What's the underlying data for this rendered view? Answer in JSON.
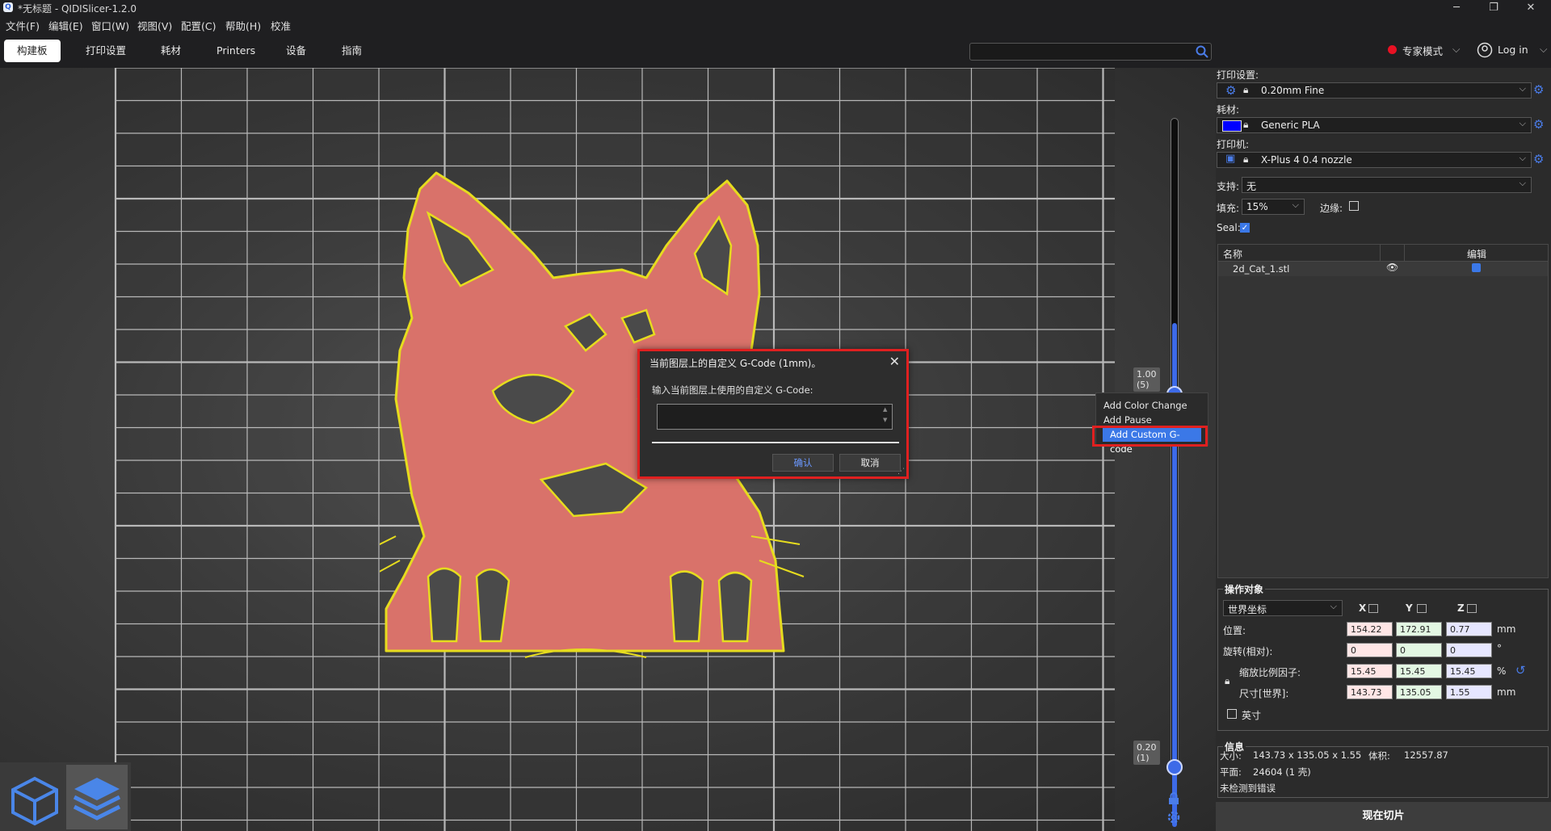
{
  "window": {
    "title": "*无标题 - QIDISlicer-1.2.0"
  },
  "menu": [
    "文件(F)",
    "编辑(E)",
    "窗口(W)",
    "视图(V)",
    "配置(C)",
    "帮助(H)",
    "校准"
  ],
  "tabs": [
    {
      "label": "构建板",
      "active": true
    },
    {
      "label": "打印设置",
      "active": false
    },
    {
      "label": "耗材",
      "active": false
    },
    {
      "label": "Printers",
      "active": false
    },
    {
      "label": "设备",
      "active": false
    },
    {
      "label": "指南",
      "active": false
    }
  ],
  "header": {
    "mode_label": "专家模式",
    "login_label": "Log in"
  },
  "slider": {
    "top_label": "1.00\n(5)",
    "bottom_label": "0.20\n(1)"
  },
  "context_menu": {
    "items": [
      "Add Color Change",
      "Add Pause",
      "Add Custom G-code"
    ],
    "selected": 2
  },
  "dialog": {
    "title": "当前图层上的自定义 G-Code (1mm)。",
    "prompt": "输入当前图层上使用的自定义 G-Code:",
    "value": "",
    "ok_label": "确认",
    "cancel_label": "取消"
  },
  "panel": {
    "print_settings_label": "打印设置:",
    "print_settings_value": "0.20mm Fine",
    "filament_label": "耗材:",
    "filament_value": "Generic PLA",
    "filament_color": "#0000ff",
    "printer_label": "打印机:",
    "printer_value": "X-Plus 4 0.4 nozzle",
    "support_label": "支持:",
    "support_value": "无",
    "infill_label": "填充:",
    "infill_value": "15%",
    "brim_label": "边缘:",
    "brim_checked": false,
    "seal_label": "Seal:",
    "seal_checked": true,
    "list_header_name": "名称",
    "list_header_edit": "编辑",
    "objects": [
      {
        "name": "2d_Cat_1.stl"
      }
    ]
  },
  "manipulation": {
    "title": "操作对象",
    "coord_system": "世界坐标",
    "axes": [
      "X",
      "Y",
      "Z"
    ],
    "rows": [
      {
        "label": "位置:",
        "x": "154.22",
        "y": "172.91",
        "z": "0.77",
        "unit": "mm"
      },
      {
        "label": "旋转(相对):",
        "x": "0",
        "y": "0",
        "z": "0",
        "unit": "°"
      },
      {
        "label": "缩放比例因子:",
        "x": "15.45",
        "y": "15.45",
        "z": "15.45",
        "unit": "%"
      },
      {
        "label": "尺寸[世界]:",
        "x": "143.73",
        "y": "135.05",
        "z": "1.55",
        "unit": "mm"
      }
    ],
    "inches_label": "英寸"
  },
  "info": {
    "title": "信息",
    "size_label": "大小:",
    "size_value": "143.73 x 135.05 x 1.55",
    "volume_label": "体积:",
    "volume_value": "12557.87",
    "facets_label": "平面:",
    "facets_value": "24604 (1 壳)",
    "errors_text": "未检测到错误"
  },
  "slice_button": "现在切片",
  "colors": {
    "accent": "#3b78e7",
    "highlight": "#e02020",
    "model_fill": "#d9726a",
    "model_outline": "#e6dc1e"
  }
}
